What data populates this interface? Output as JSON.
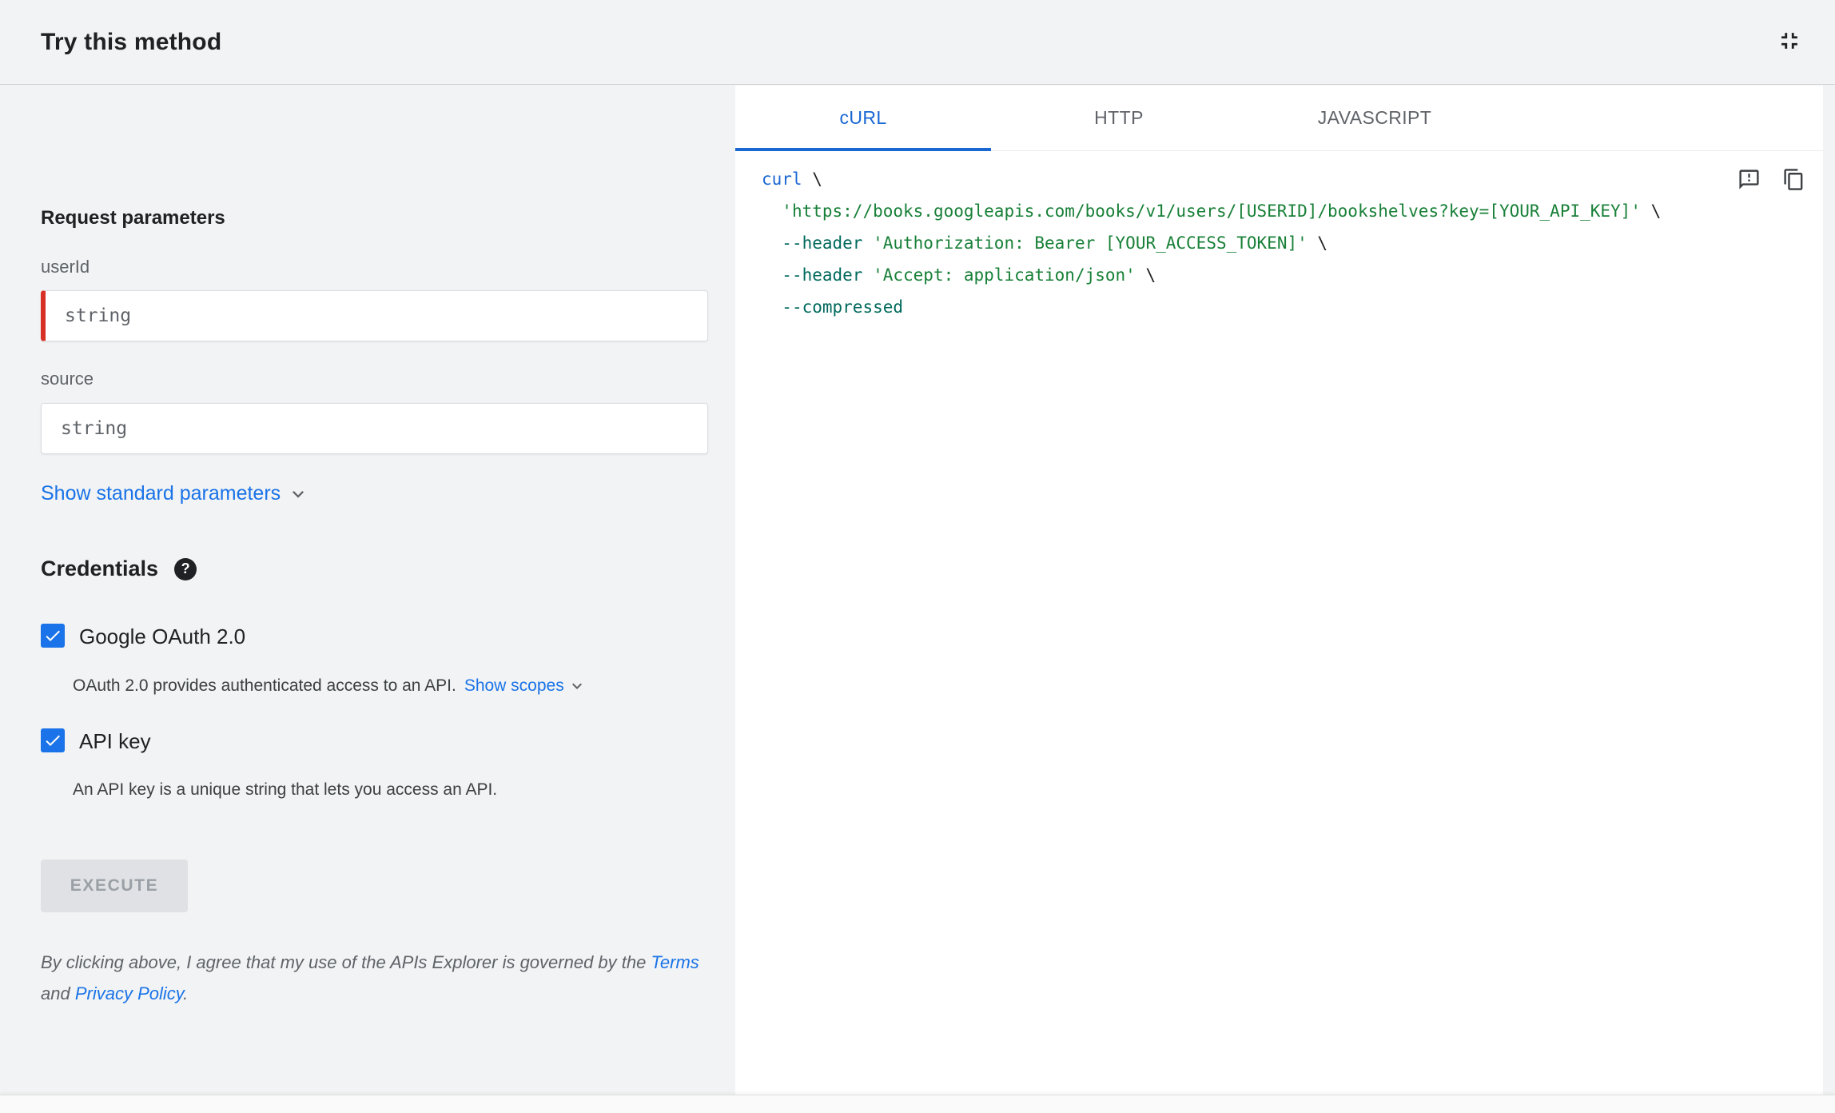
{
  "header": {
    "title": "Try this method"
  },
  "request": {
    "title": "Request parameters",
    "fields": [
      {
        "label": "userId",
        "placeholder": "string",
        "required": true
      },
      {
        "label": "source",
        "placeholder": "string",
        "required": false
      }
    ],
    "show_standard_label": "Show standard parameters"
  },
  "credentials": {
    "title": "Credentials",
    "help_glyph": "?",
    "oauth": {
      "label": "Google OAuth 2.0",
      "checked": true,
      "description": "OAuth 2.0 provides authenticated access to an API.",
      "scopes_label": "Show scopes"
    },
    "api_key": {
      "label": "API key",
      "checked": true,
      "description": "An API key is a unique string that lets you access an API."
    }
  },
  "execute_label": "EXECUTE",
  "disclaimer": {
    "pre": "By clicking above, I agree that my use of the APIs Explorer is governed by the ",
    "terms": "Terms",
    "mid": " and ",
    "privacy": "Privacy Policy",
    "post": "."
  },
  "tabs": [
    {
      "label": "cURL",
      "active": true
    },
    {
      "label": "HTTP",
      "active": false
    },
    {
      "label": "JAVASCRIPT",
      "active": false
    }
  ],
  "code": {
    "colors": {
      "kwd": "#1967d2",
      "str": "#188038",
      "flag": "#00695c",
      "pln": "#202124"
    },
    "lines": [
      {
        "tokens": [
          {
            "t": "curl",
            "c": "kwd"
          },
          {
            "t": " \\",
            "c": "pln"
          }
        ]
      },
      {
        "tokens": [
          {
            "t": "  ",
            "c": "pln"
          },
          {
            "t": "'https://books.googleapis.com/books/v1/users/[USERID]/bookshelves?key=[YOUR_API_KEY]'",
            "c": "str"
          },
          {
            "t": " \\",
            "c": "pln"
          }
        ]
      },
      {
        "tokens": [
          {
            "t": "  ",
            "c": "pln"
          },
          {
            "t": "--header ",
            "c": "flag"
          },
          {
            "t": "'Authorization: Bearer [YOUR_ACCESS_TOKEN]'",
            "c": "str"
          },
          {
            "t": " \\",
            "c": "pln"
          }
        ]
      },
      {
        "tokens": [
          {
            "t": "  ",
            "c": "pln"
          },
          {
            "t": "--header ",
            "c": "flag"
          },
          {
            "t": "'Accept: application/json'",
            "c": "str"
          },
          {
            "t": " \\",
            "c": "pln"
          }
        ]
      },
      {
        "tokens": [
          {
            "t": "  ",
            "c": "pln"
          },
          {
            "t": "--compressed",
            "c": "flag"
          }
        ]
      }
    ]
  },
  "colors": {
    "accent": "#1a73e8",
    "tab_active": "#1967d2",
    "required_marker": "#d93025",
    "panel_background": "#f1f3f4"
  }
}
